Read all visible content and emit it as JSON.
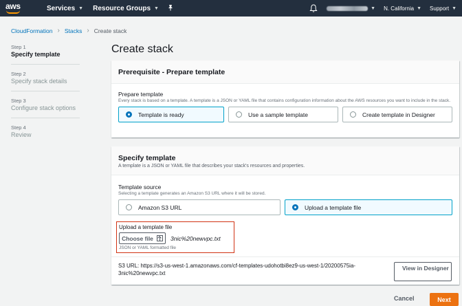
{
  "topnav": {
    "logo": "aws",
    "services": "Services",
    "resource_groups": "Resource Groups",
    "region": "N. California",
    "support": "Support",
    "icons": [
      "caret-down-icon",
      "pin-icon",
      "bell-icon"
    ]
  },
  "breadcrumb": {
    "items": [
      "CloudFormation",
      "Stacks"
    ],
    "current": "Create stack"
  },
  "steps": [
    {
      "num": "Step 1",
      "label": "Specify template"
    },
    {
      "num": "Step 2",
      "label": "Specify stack details"
    },
    {
      "num": "Step 3",
      "label": "Configure stack options"
    },
    {
      "num": "Step 4",
      "label": "Review"
    }
  ],
  "page": {
    "title": "Create stack"
  },
  "prerequisite": {
    "title": "Prerequisite - Prepare template",
    "field_label": "Prepare template",
    "field_desc": "Every stack is based on a template. A template is a JSON or YAML file that contains configuration information about the AWS resources you want to include in the stack.",
    "options": [
      "Template is ready",
      "Use a sample template",
      "Create template in Designer"
    ],
    "selected": "Template is ready"
  },
  "specify": {
    "title": "Specify template",
    "desc": "A template is a JSON or YAML file that describes your stack's resources and properties.",
    "source_label": "Template source",
    "source_desc": "Selecting a template generates an Amazon S3 URL where it will be stored.",
    "options": [
      "Amazon S3 URL",
      "Upload a template file"
    ],
    "selected": "Upload a template file",
    "upload_label": "Upload a template file",
    "choose_file": "Choose file",
    "file_name": "3nic%20newvpc.txt",
    "file_hint": "JSON or YAML formatted file",
    "s3_url": "S3 URL:  https://s3-us-west-1.amazonaws.com/cf-templates-udohotbi8ez9-us-west-1/20200575ia-3nic%20newvpc.txt",
    "view_designer": "View in Designer"
  },
  "footer": {
    "cancel": "Cancel",
    "next": "Next"
  },
  "colors": {
    "nav_bg": "#232f3e",
    "accent_orange": "#ec7211",
    "link_blue": "#0073bb",
    "highlight_red": "#d13212"
  }
}
